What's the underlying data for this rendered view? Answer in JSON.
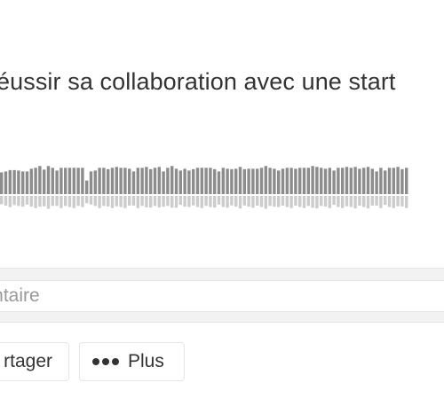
{
  "track": {
    "title": "éussir sa collaboration avec une start"
  },
  "waveform": {
    "played_color": "#8c8c8c",
    "remaining_color": "#cccccc",
    "levels": [
      0.48,
      0.5,
      0.53,
      0.53,
      0.52,
      0.5,
      0.5,
      0.56,
      0.58,
      0.62,
      0.54,
      0.62,
      0.58,
      0.52,
      0.58,
      0.58,
      0.58,
      0.58,
      0.58,
      0.58,
      0.3,
      0.5,
      0.52,
      0.58,
      0.58,
      0.55,
      0.58,
      0.6,
      0.58,
      0.58,
      0.56,
      0.5,
      0.58,
      0.58,
      0.6,
      0.55,
      0.58,
      0.6,
      0.5,
      0.58,
      0.62,
      0.56,
      0.52,
      0.56,
      0.52,
      0.55,
      0.58,
      0.58,
      0.58,
      0.58,
      0.55,
      0.5,
      0.58,
      0.56,
      0.55,
      0.56,
      0.6,
      0.55,
      0.56,
      0.56,
      0.56,
      0.58,
      0.62,
      0.58,
      0.56,
      0.52,
      0.56,
      0.58,
      0.58,
      0.56,
      0.58,
      0.58,
      0.58,
      0.62,
      0.6,
      0.58,
      0.56,
      0.58,
      0.52,
      0.58,
      0.58,
      0.6,
      0.58,
      0.6,
      0.56,
      0.58,
      0.6,
      0.56,
      0.5,
      0.58,
      0.52,
      0.58,
      0.58,
      0.6,
      0.55,
      0.58
    ]
  },
  "comment": {
    "placeholder": "mentaire",
    "value": ""
  },
  "actions": {
    "share_label": "rtager",
    "more_label": "Plus"
  }
}
